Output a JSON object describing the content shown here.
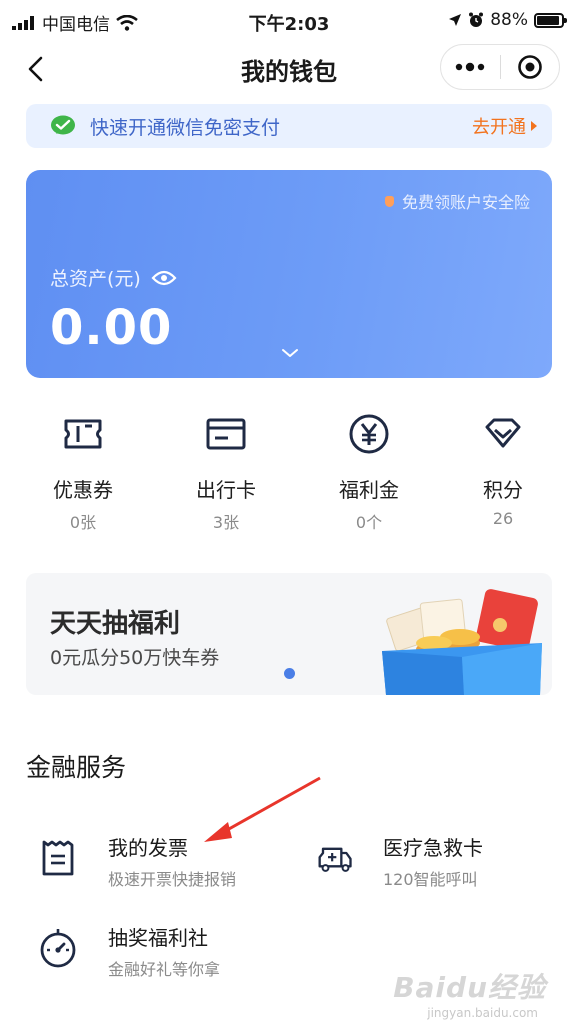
{
  "status_bar": {
    "carrier": "中国电信",
    "time": "下午2:03",
    "battery": "88%",
    "icons": [
      "signal-icon",
      "wifi-icon",
      "location-icon",
      "alarm-icon",
      "battery-icon"
    ]
  },
  "nav": {
    "title": "我的钱包",
    "icons": [
      "back-icon",
      "more-icon",
      "close-miniprogram-icon"
    ]
  },
  "banner": {
    "text": "快速开通微信免密支付",
    "action": "去开通",
    "icon": "wechat-pay-icon"
  },
  "asset_card": {
    "insurance_text": "免费领账户安全险",
    "label": "总资产(元)",
    "value": "0.00",
    "icons": [
      "shield-icon",
      "eye-icon",
      "chevron-down-icon"
    ]
  },
  "quick_items": [
    {
      "label": "优惠券",
      "sub": "0张",
      "icon": "coupon-icon"
    },
    {
      "label": "出行卡",
      "sub": "3张",
      "icon": "travel-card-icon"
    },
    {
      "label": "福利金",
      "sub": "0个",
      "icon": "yuan-icon"
    },
    {
      "label": "积分",
      "sub": "26",
      "icon": "points-icon"
    }
  ],
  "promo": {
    "title": "天天抽福利",
    "subtitle": "0元瓜分50万快车券",
    "art_icon": "gift-box-coupons-icon"
  },
  "finance": {
    "title": "金融服务",
    "services": [
      {
        "name": "我的发票",
        "desc": "极速开票快捷报销",
        "icon": "invoice-icon"
      },
      {
        "name": "医疗急救卡",
        "desc": "120智能呼叫",
        "icon": "ambulance-icon"
      },
      {
        "name": "抽奖福利社",
        "desc": "金融好礼等你拿",
        "icon": "lottery-dial-icon"
      }
    ]
  },
  "watermark": {
    "text": "Baidu经验",
    "sub": "jingyan.baidu.com"
  },
  "colors": {
    "accent_blue": "#5f8ff2",
    "banner_text": "#3f66c8",
    "action_orange": "#f2731e",
    "annotation_red": "#e8352b"
  }
}
